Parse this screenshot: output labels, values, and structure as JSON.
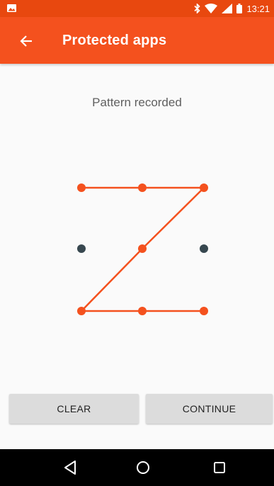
{
  "status_bar": {
    "time": "13:21",
    "icons": [
      "image-icon",
      "bluetooth-icon",
      "wifi-icon",
      "signal-icon",
      "battery-icon"
    ]
  },
  "app_bar": {
    "title": "Protected apps",
    "back_icon": "arrow-back-icon",
    "background": "#f4511e"
  },
  "message": "Pattern recorded",
  "pattern": {
    "active_color": "#f4511e",
    "inactive_color": "#37474f",
    "sequence": [
      1,
      2,
      3,
      5,
      7,
      8,
      9
    ],
    "inactive_dots": [
      4,
      6
    ]
  },
  "buttons": {
    "clear": "CLEAR",
    "continue": "CONTINUE"
  },
  "nav_bar": {
    "icons": [
      "back-triangle-icon",
      "home-circle-icon",
      "recents-square-icon"
    ]
  }
}
